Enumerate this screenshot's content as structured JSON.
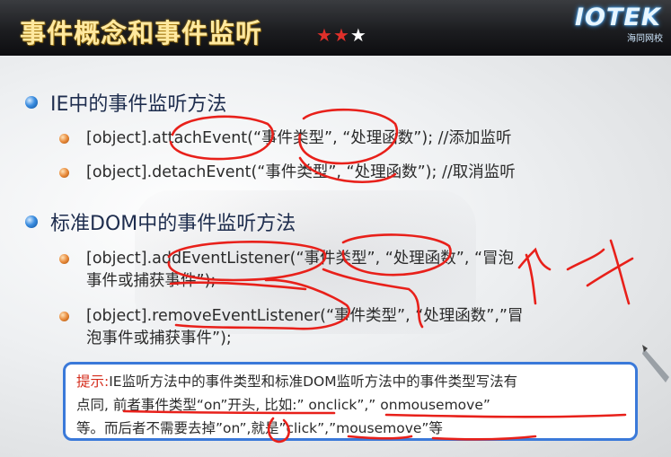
{
  "title": "事件概念和事件监听",
  "stars": [
    {
      "symbol": "★",
      "color": "#e0302a"
    },
    {
      "symbol": "★",
      "color": "#e0302a"
    },
    {
      "symbol": "★",
      "color": "#ffffff"
    }
  ],
  "logo": {
    "main": "IOTEK",
    "sub": "海同网校"
  },
  "section1": {
    "heading": "IE中的事件监听方法",
    "items": [
      "[object].attachEvent(“事件类型”, “处理函数”); //添加监听",
      "[object].detachEvent(“事件类型”, “处理函数”); //取消监听"
    ]
  },
  "section2": {
    "heading": "标准DOM中的事件监听方法",
    "items": [
      {
        "line1": "[object].addEventListener(“事件类型”, “处理函数”, “冒泡",
        "line2": "事件或捕获事件”);"
      },
      {
        "line1": "[object].removeEventListener(“事件类型”, “处理函数”,”冒",
        "line2": "泡事件或捕获事件”);"
      }
    ]
  },
  "tip": {
    "label": "提示:",
    "line1": "IE监听方法中的事件类型和标准DOM监听方法中的事件类型写法有",
    "line2": "点同, 前者事件类型“on”开头, 比如:” onclick”,” onmousemove”",
    "line3": "等。而后者不需要去掉”on”,就是”click”,”mousemove”等"
  },
  "colors": {
    "accent_blue": "#3a79d9",
    "annotation_red": "#e8201a",
    "title_gold": "#ffe9a0"
  }
}
